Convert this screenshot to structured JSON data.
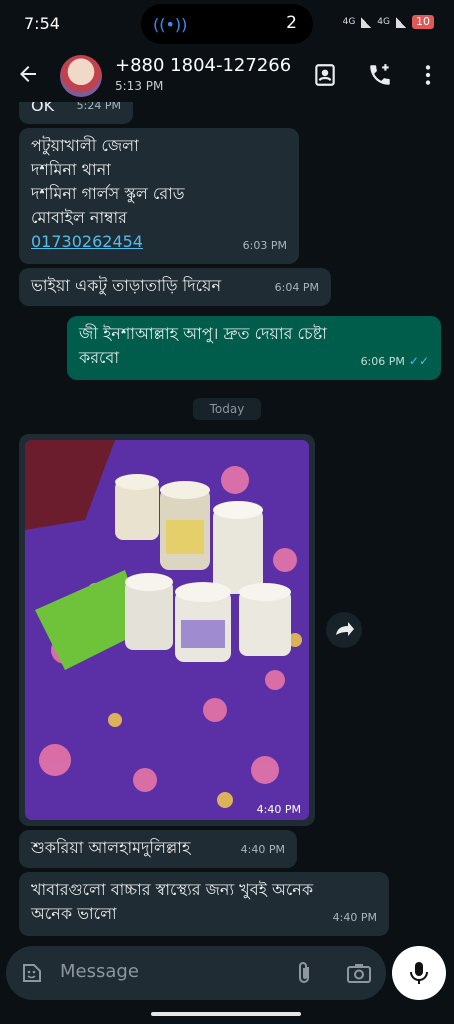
{
  "status_bar": {
    "time": "7:54",
    "pill_count": "2",
    "network_1": "4G",
    "network_2": "4G",
    "battery": "10",
    "icons": [
      "cast-icon",
      "signal-icon",
      "battery-icon"
    ]
  },
  "header": {
    "contact_name": "+880 1804-127266",
    "last_seen": "5:13 PM",
    "icons": [
      "back-arrow-icon",
      "contact-card-icon",
      "add-call-icon",
      "more-vertical-icon"
    ]
  },
  "messages": [
    {
      "type": "incoming",
      "text_partial": "OK",
      "time": "5:24 PM"
    },
    {
      "type": "incoming",
      "lines": [
        "পটুয়াখালী জেলা",
        "দশমিনা থানা",
        "দশমিনা গার্লস স্কুল রোড",
        "মোবাইল নাম্বার"
      ],
      "link": "01730262454",
      "time": "6:03 PM"
    },
    {
      "type": "incoming",
      "text": "ভাইয়া একটু তাড়াতাড়ি দিয়েন",
      "time": "6:04 PM"
    },
    {
      "type": "outgoing",
      "lines": [
        "জী ইনশাআল্লাহ আপু। দ্রুত দেয়ার চেষ্টা",
        "করবো"
      ],
      "time": "6:06 PM",
      "ticks": "✓✓"
    }
  ],
  "day_divider": "Today",
  "image_message": {
    "time": "4:40 PM",
    "forward_icon": "forward-icon"
  },
  "after_image": [
    {
      "type": "incoming",
      "text": "শুকরিয়া আলহামদুলিল্লাহ",
      "time": "4:40 PM"
    },
    {
      "type": "incoming",
      "lines": [
        "খাবারগুলো বাচ্চার স্বাস্থ্যের জন্য খুবই অনেক",
        "অনেক ভালো"
      ],
      "time": "4:40 PM"
    }
  ],
  "composer": {
    "placeholder": "Message",
    "icons": [
      "sticker-icon",
      "attach-icon",
      "camera-icon",
      "mic-icon"
    ]
  },
  "colors": {
    "background": "#0b1014",
    "incoming_bubble": "#202c33",
    "outgoing_bubble": "#005c4b",
    "link": "#53bdeb",
    "mic_button": "#ffffff"
  }
}
